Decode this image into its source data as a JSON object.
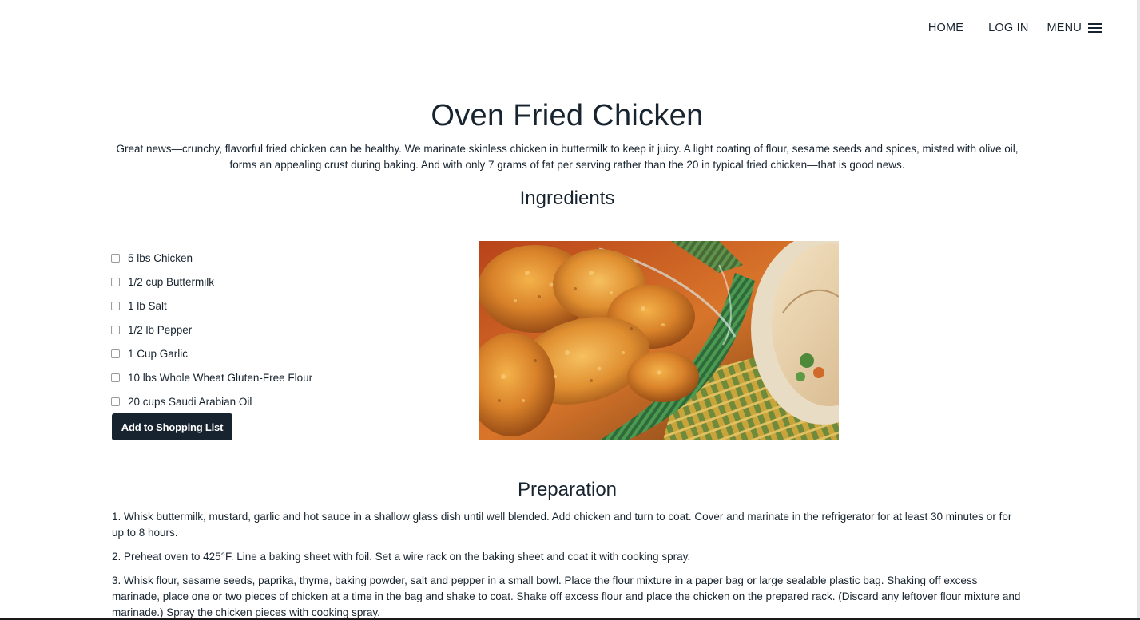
{
  "nav": {
    "home": "HOME",
    "login": "LOG IN",
    "menu": "MENU",
    "menu_icon": "hamburger-icon"
  },
  "recipe": {
    "title": "Oven Fried Chicken",
    "description": "Great news—crunchy, flavorful fried chicken can be healthy. We marinate skinless chicken in buttermilk to keep it juicy. A light coating of flour, sesame seeds and spices, misted with olive oil, forms an appealing crust during baking. And with only 7 grams of fat per serving rather than the 20 in typical fried chicken—that is good news."
  },
  "ingredients": {
    "heading": "Ingredients",
    "items": [
      {
        "label": "5 lbs Chicken",
        "checked": false
      },
      {
        "label": "1/2 cup Buttermilk",
        "checked": false
      },
      {
        "label": "1 lb Salt",
        "checked": false
      },
      {
        "label": "1/2 lb Pepper",
        "checked": false
      },
      {
        "label": "1 Cup Garlic",
        "checked": false
      },
      {
        "label": "10 lbs Whole Wheat Gluten-Free Flour",
        "checked": false
      },
      {
        "label": "20 cups Saudi Arabian Oil",
        "checked": false
      }
    ],
    "add_button": "Add to Shopping List"
  },
  "preparation": {
    "heading": "Preparation",
    "steps": [
      "1. Whisk buttermilk, mustard, garlic and hot sauce in a shallow glass dish until well blended. Add chicken and turn to coat. Cover and marinate in the refrigerator for at least 30 minutes or for up to 8 hours.",
      "2. Preheat oven to 425°F. Line a baking sheet with foil. Set a wire rack on the baking sheet and coat it with cooking spray.",
      "3. Whisk flour, sesame seeds, paprika, thyme, baking powder, salt and pepper in a small bowl. Place the flour mixture in a paper bag or large sealable plastic bag. Shaking off excess marinade, place one or two pieces of chicken at a time in the bag and shake to coat. Shake off excess flour and place the chicken on the prepared rack. (Discard any leftover flour mixture and marinade.) Spray the chicken pieces with cooking spray."
    ]
  },
  "colors": {
    "text": "#17232e",
    "button_bg": "#17232e",
    "button_text": "#ffffff"
  }
}
